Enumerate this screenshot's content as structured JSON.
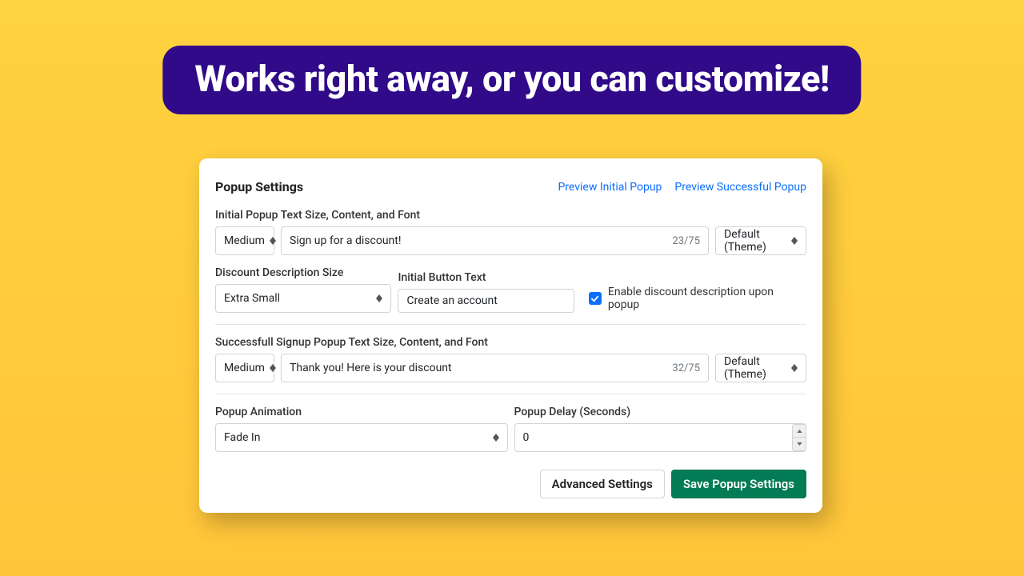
{
  "hero": "Works right away, or you can customize!",
  "card": {
    "title": "Popup Settings",
    "links": {
      "preview_initial": "Preview Initial Popup",
      "preview_success": "Preview Successful Popup"
    },
    "initial_popup_label": "Initial Popup Text Size, Content, and Font",
    "initial_size": "Medium",
    "initial_text": "Sign up for a discount!",
    "initial_counter": "23/75",
    "initial_font": "Default (Theme)",
    "discount_size_label": "Discount Description Size",
    "discount_size": "Extra Small",
    "initial_button_label": "Initial Button Text",
    "initial_button_text": "Create an account",
    "enable_discount_label": "Enable discount description upon popup",
    "success_label": "Successfull Signup Popup Text Size, Content, and Font",
    "success_size": "Medium",
    "success_text": "Thank you! Here is your discount",
    "success_counter": "32/75",
    "success_font": "Default (Theme)",
    "animation_label": "Popup Animation",
    "animation_value": "Fade In",
    "delay_label": "Popup Delay (Seconds)",
    "delay_value": "0",
    "advanced_btn": "Advanced Settings",
    "save_btn": "Save Popup Settings"
  }
}
